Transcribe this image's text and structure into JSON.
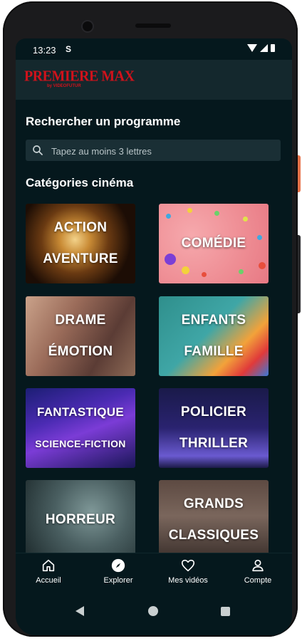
{
  "status_bar": {
    "time": "13:23",
    "notification_glyph": "S"
  },
  "app": {
    "logo_main": "PREMIERE MAX",
    "logo_sub": "by VIDEOFUTUR"
  },
  "search": {
    "title": "Rechercher un programme",
    "placeholder": "Tapez au moins 3 lettres"
  },
  "categories": {
    "title": "Catégories cinéma",
    "items": [
      {
        "line1": "ACTION",
        "line2": "AVENTURE"
      },
      {
        "line1": "COMÉDIE",
        "line2": ""
      },
      {
        "line1": "DRAME",
        "line2": "ÉMOTION"
      },
      {
        "line1": "ENFANTS",
        "line2": "FAMILLE"
      },
      {
        "line1": "FANTASTIQUE",
        "line2": "SCIENCE-FICTION"
      },
      {
        "line1": "POLICIER",
        "line2": "THRILLER"
      },
      {
        "line1": "HORREUR",
        "line2": ""
      },
      {
        "line1": "GRANDS",
        "line2": "CLASSIQUES"
      }
    ]
  },
  "bottom_nav": {
    "items": [
      {
        "label": "Accueil",
        "icon": "home-icon"
      },
      {
        "label": "Explorer",
        "icon": "compass-icon"
      },
      {
        "label": "Mes vidéos",
        "icon": "heart-icon"
      },
      {
        "label": "Compte",
        "icon": "user-icon"
      }
    ]
  },
  "colors": {
    "background": "#05181d",
    "brand": "#d0121b",
    "appbar": "#14282d",
    "search_field": "#1a2f35"
  }
}
